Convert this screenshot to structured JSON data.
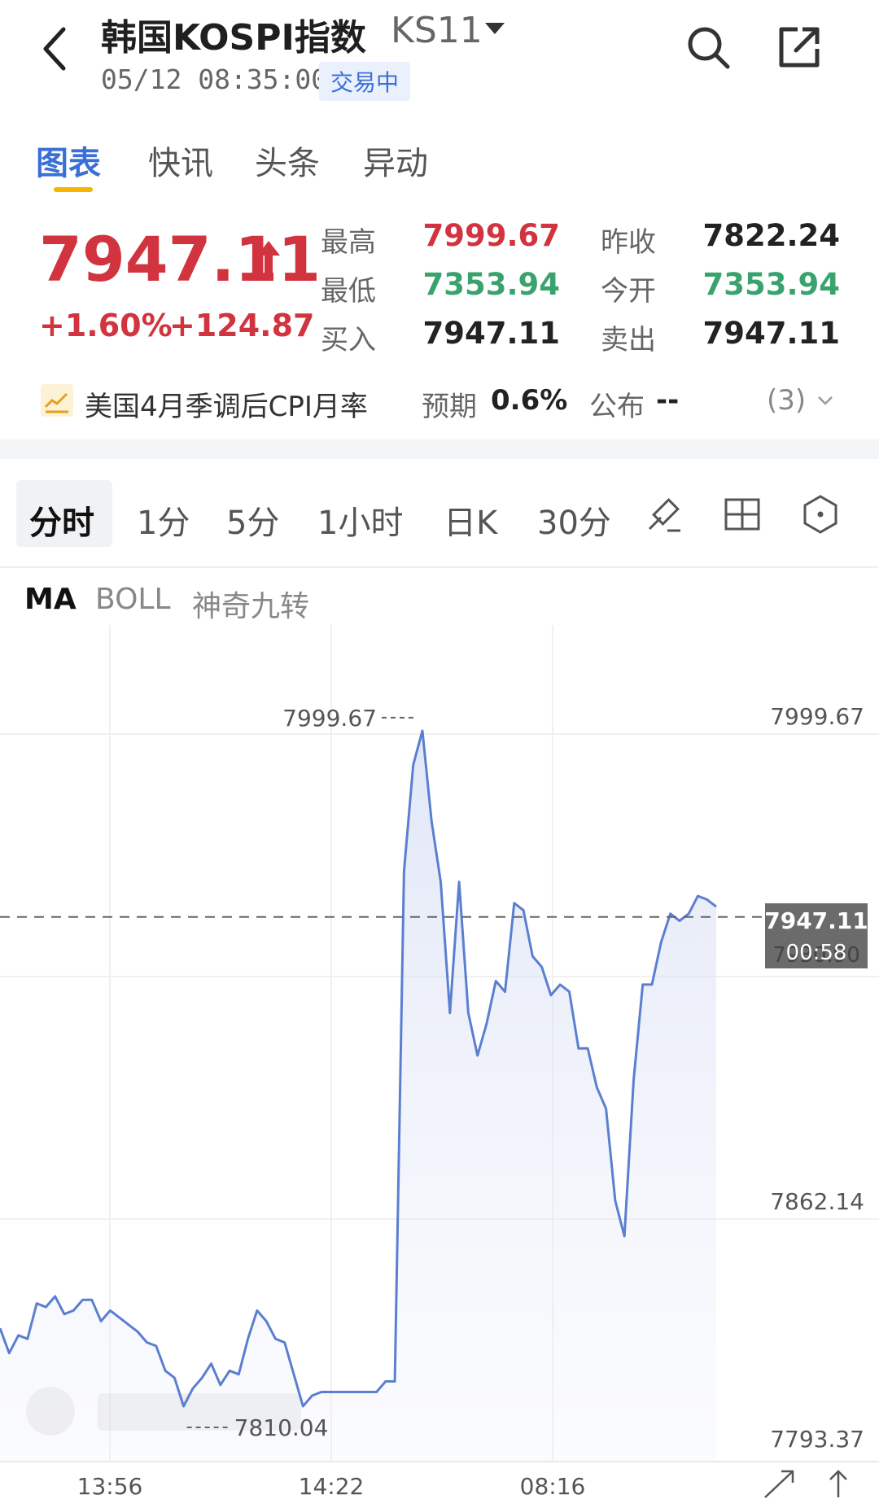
{
  "header": {
    "title": "韩国KOSPI指数",
    "code": "KS11",
    "datetime": "05/12 08:35:00",
    "status": "交易中"
  },
  "tabs": [
    {
      "label": "图表",
      "active": true
    },
    {
      "label": "快讯"
    },
    {
      "label": "头条"
    },
    {
      "label": "异动"
    }
  ],
  "quote": {
    "price": "7947.11",
    "change_pct": "+1.60%",
    "change_abs": "+124.87",
    "high_label": "最高",
    "high": "7999.67",
    "low_label": "最低",
    "low": "7353.94",
    "bid_label": "买入",
    "bid": "7947.11",
    "prev_close_label": "昨收",
    "prev_close": "7822.24",
    "open_label": "今开",
    "open": "7353.94",
    "ask_label": "卖出",
    "ask": "7947.11"
  },
  "news": {
    "title": "美国4月季调后CPI月率",
    "expect_label": "预期",
    "expect": "0.6%",
    "publish_label": "公布",
    "publish": "--",
    "count": "(3)"
  },
  "periods": [
    "分时",
    "1分",
    "5分",
    "1小时",
    "日K",
    "30分"
  ],
  "indicators": [
    "MA",
    "BOLL",
    "神奇九转"
  ],
  "colors": {
    "up": "#d1343f",
    "down": "#3aa36d",
    "accent": "#3a6fd8",
    "line": "#5b7fd0"
  },
  "chart_data": {
    "type": "line",
    "y_labels": [
      "7999.67",
      "7862.14",
      "7793.37"
    ],
    "max_marker": "7999.67",
    "min_marker": "7810.04",
    "current_tag": "7947.11",
    "timer_tag": "00:58",
    "hidden_label": "7930.90",
    "x_ticks": [
      "13:56",
      "14:22",
      "08:16"
    ],
    "ylim": [
      7793.37,
      8029.5
    ],
    "series": [
      {
        "values": [
          7831,
          7824,
          7829,
          7828,
          7838,
          7837,
          7840,
          7835,
          7836,
          7839,
          7839,
          7833,
          7836,
          7834,
          7832,
          7830,
          7827,
          7826,
          7819,
          7817,
          7809,
          7814,
          7817,
          7821,
          7815,
          7819,
          7818,
          7828,
          7836,
          7833,
          7828,
          7827,
          7818,
          7809,
          7812,
          7813,
          7813,
          7813,
          7813,
          7813,
          7813,
          7813,
          7816,
          7816,
          7960,
          7990,
          7999.67,
          7974,
          7957,
          7920,
          7957,
          7920,
          7908,
          7917,
          7929,
          7926,
          7951,
          7949,
          7936,
          7933,
          7925,
          7928,
          7926,
          7910,
          7910,
          7899,
          7893,
          7867,
          7857,
          7901,
          7928,
          7928,
          7940,
          7948,
          7946,
          7948,
          7953,
          7952,
          7950
        ]
      }
    ]
  }
}
